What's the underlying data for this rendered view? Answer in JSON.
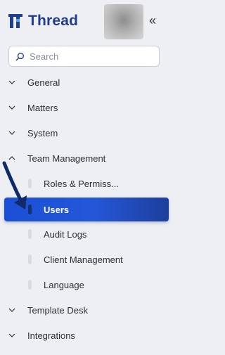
{
  "brand": {
    "name": "Thread"
  },
  "header": {
    "collapse_glyph": "«"
  },
  "search": {
    "placeholder": "Search"
  },
  "nav": {
    "general": "General",
    "matters": "Matters",
    "system": "System",
    "team_management": "Team Management",
    "team_children": {
      "roles": "Roles & Permiss...",
      "users": "Users",
      "audit_logs": "Audit Logs",
      "client_management": "Client Management",
      "language": "Language"
    },
    "template_desk": "Template Desk",
    "integrations": "Integrations"
  },
  "icons": {
    "logo": "thread-logo-icon",
    "collapse": "double-chevron-left-icon",
    "search": "search-icon",
    "collapsed": "chevron-down-icon",
    "expanded": "chevron-up-icon",
    "pointer": "arrow-icon"
  },
  "colors": {
    "brand": "#1f3f8e",
    "active_start": "#1a4fd6",
    "active_end": "#1d3f9c",
    "background": "#edeff3"
  }
}
